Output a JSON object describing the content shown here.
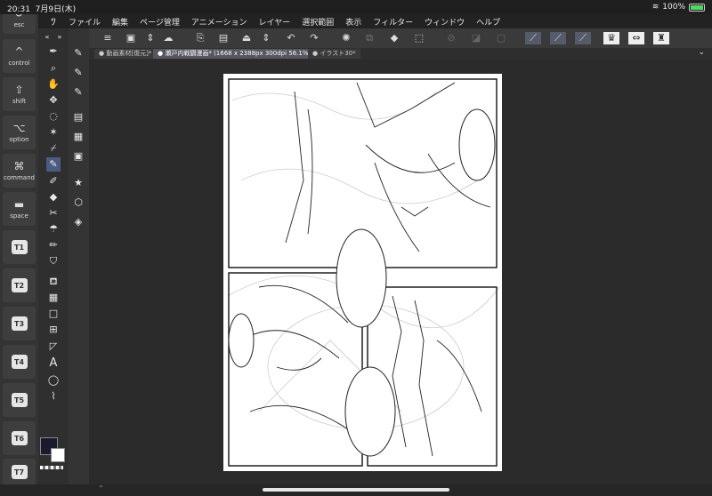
{
  "status": {
    "time": "20:31",
    "date": "7月9日(木)",
    "battery": "100%"
  },
  "menu": {
    "items": [
      "ファイル",
      "編集",
      "ページ管理",
      "アニメーション",
      "レイヤー",
      "選択範囲",
      "表示",
      "フィルター",
      "ウィンドウ",
      "ヘルプ"
    ]
  },
  "modifiers": [
    {
      "glyph": "↺",
      "label": "esc"
    },
    {
      "glyph": "^",
      "label": "control"
    },
    {
      "glyph": "⇧",
      "label": "shift"
    },
    {
      "glyph": "⌥",
      "label": "option"
    },
    {
      "glyph": "⌘",
      "label": "command"
    },
    {
      "glyph": "▬",
      "label": "space"
    }
  ],
  "shortcuts": [
    "T1",
    "T2",
    "T3",
    "T4",
    "T5",
    "T6",
    "T7"
  ],
  "tabs": [
    {
      "label": "動画素材[復元]*",
      "active": false
    },
    {
      "label": "瀬戸内戦闘漫画* (1668 x 2388px 300dpi 56.1%)",
      "active": true
    },
    {
      "label": "イラスト30*",
      "active": false
    }
  ],
  "colors": {
    "main": "#1a1a2e",
    "sub": "#ffffff",
    "accent": "#5a7ab8"
  }
}
